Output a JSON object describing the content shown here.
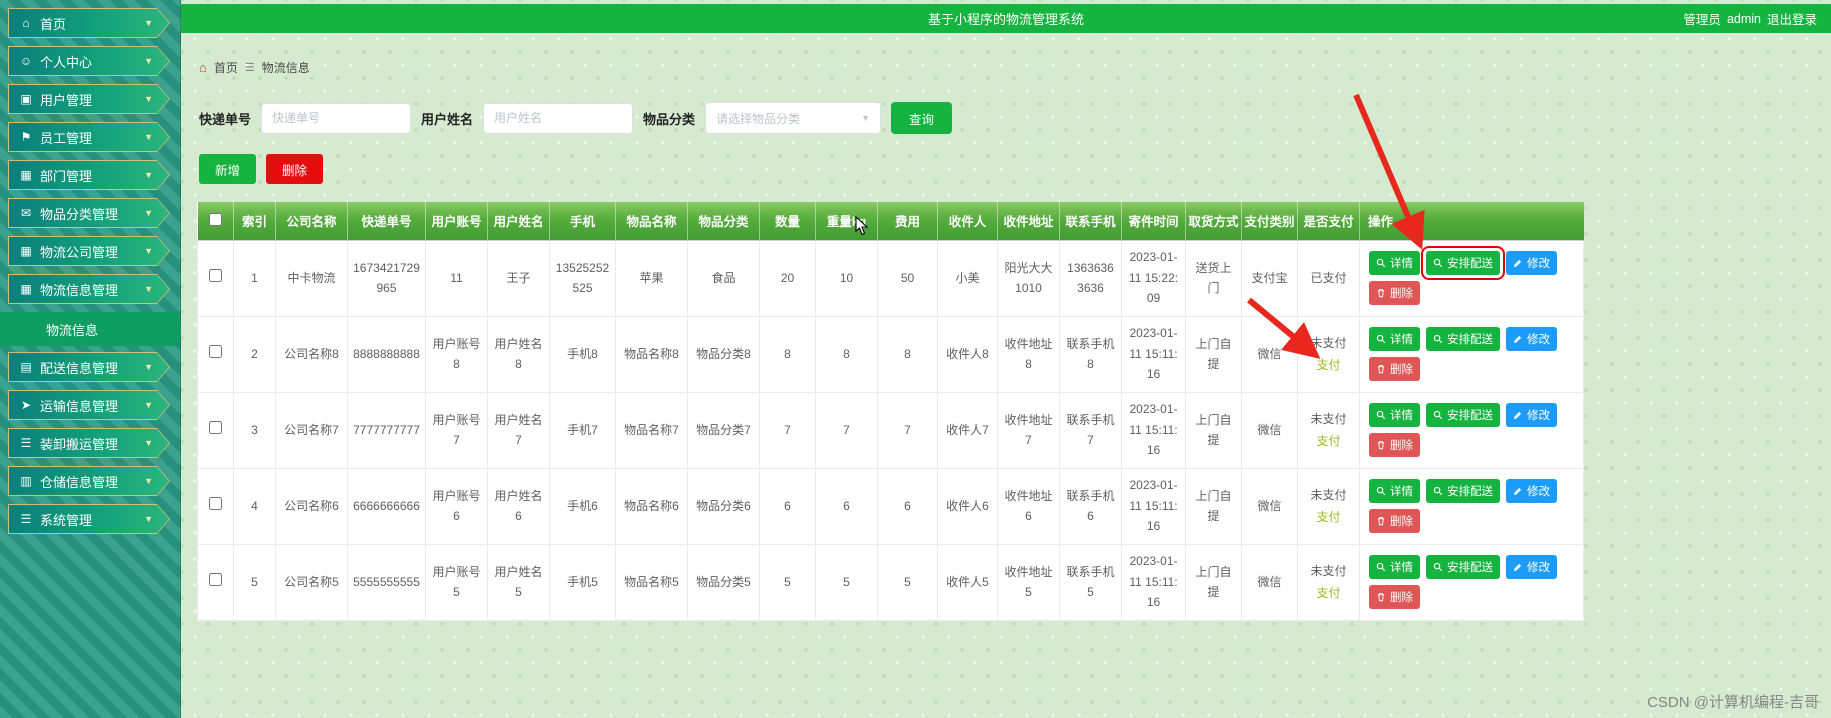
{
  "app": {
    "title": "基于小程序的物流管理系统",
    "user_role": "管理员",
    "username": "admin",
    "logout": "退出登录"
  },
  "sidebar": {
    "items": [
      {
        "label": "首页",
        "icon": "home-icon"
      },
      {
        "label": "个人中心",
        "icon": "user-icon"
      },
      {
        "label": "用户管理",
        "icon": "users-icon"
      },
      {
        "label": "员工管理",
        "icon": "flag-icon"
      },
      {
        "label": "部门管理",
        "icon": "department-icon"
      },
      {
        "label": "物品分类管理",
        "icon": "category-icon"
      },
      {
        "label": "物流公司管理",
        "icon": "company-icon"
      },
      {
        "label": "物流信息管理",
        "icon": "logistics-info-icon"
      },
      {
        "label": "物流信息",
        "type": "sub",
        "active": true
      },
      {
        "label": "配送信息管理",
        "icon": "delivery-icon"
      },
      {
        "label": "运输信息管理",
        "icon": "transport-icon"
      },
      {
        "label": "装卸搬运管理",
        "icon": "handling-icon"
      },
      {
        "label": "仓储信息管理",
        "icon": "warehouse-icon"
      },
      {
        "label": "系统管理",
        "icon": "system-icon"
      }
    ]
  },
  "breadcrumb": {
    "home": "首页",
    "current": "物流信息"
  },
  "filters": {
    "express_label": "快递单号",
    "express_placeholder": "快递单号",
    "name_label": "用户姓名",
    "name_placeholder": "用户姓名",
    "category_label": "物品分类",
    "category_placeholder": "请选择物品分类",
    "search_button": "查询"
  },
  "toolbar": {
    "add_button": "新增",
    "delete_button": "删除"
  },
  "table": {
    "columns": [
      {
        "key": "index",
        "label": "索引"
      },
      {
        "key": "company",
        "label": "公司名称"
      },
      {
        "key": "express_no",
        "label": "快递单号"
      },
      {
        "key": "account",
        "label": "用户账号"
      },
      {
        "key": "username",
        "label": "用户姓名"
      },
      {
        "key": "phone",
        "label": "手机"
      },
      {
        "key": "item_name",
        "label": "物品名称"
      },
      {
        "key": "category",
        "label": "物品分类"
      },
      {
        "key": "quantity",
        "label": "数量"
      },
      {
        "key": "weight",
        "label": "重量kg"
      },
      {
        "key": "fee",
        "label": "费用"
      },
      {
        "key": "receiver",
        "label": "收件人"
      },
      {
        "key": "address",
        "label": "收件地址"
      },
      {
        "key": "contact_phone",
        "label": "联系手机"
      },
      {
        "key": "send_time",
        "label": "寄件时间"
      },
      {
        "key": "pickup_method",
        "label": "取货方式"
      },
      {
        "key": "pay_type",
        "label": "支付类别"
      },
      {
        "key": "paid_status",
        "label": "是否支付"
      },
      {
        "key": "actions",
        "label": "操作"
      }
    ],
    "action_labels": {
      "detail": "详情",
      "arrange": "安排配送",
      "edit": "修改",
      "delete": "删除",
      "pay": "支付"
    },
    "rows": [
      {
        "index": "1",
        "company": "中卡物流",
        "express_no": "1673421729965",
        "account": "11",
        "username": "王子",
        "phone": "13525252525",
        "item_name": "苹果",
        "category": "食品",
        "quantity": "20",
        "weight": "10",
        "fee": "50",
        "receiver": "小美",
        "address": "阳光大大1010",
        "contact_phone": "13636363636",
        "send_time": "2023-01-11 15:22:09",
        "pickup_method": "送货上门",
        "pay_type": "支付宝",
        "paid_status": "已支付",
        "show_pay_link": false,
        "highlight_arrange": true
      },
      {
        "index": "2",
        "company": "公司名称8",
        "express_no": "8888888888",
        "account": "用户账号8",
        "username": "用户姓名8",
        "phone": "手机8",
        "item_name": "物品名称8",
        "category": "物品分类8",
        "quantity": "8",
        "weight": "8",
        "fee": "8",
        "receiver": "收件人8",
        "address": "收件地址8",
        "contact_phone": "联系手机8",
        "send_time": "2023-01-11 15:11:16",
        "pickup_method": "上门自提",
        "pay_type": "微信",
        "paid_status": "未支付",
        "show_pay_link": true,
        "highlight_arrange": false
      },
      {
        "index": "3",
        "company": "公司名称7",
        "express_no": "7777777777",
        "account": "用户账号7",
        "username": "用户姓名7",
        "phone": "手机7",
        "item_name": "物品名称7",
        "category": "物品分类7",
        "quantity": "7",
        "weight": "7",
        "fee": "7",
        "receiver": "收件人7",
        "address": "收件地址7",
        "contact_phone": "联系手机7",
        "send_time": "2023-01-11 15:11:16",
        "pickup_method": "上门自提",
        "pay_type": "微信",
        "paid_status": "未支付",
        "show_pay_link": true,
        "highlight_arrange": false
      },
      {
        "index": "4",
        "company": "公司名称6",
        "express_no": "6666666666",
        "account": "用户账号6",
        "username": "用户姓名6",
        "phone": "手机6",
        "item_name": "物品名称6",
        "category": "物品分类6",
        "quantity": "6",
        "weight": "6",
        "fee": "6",
        "receiver": "收件人6",
        "address": "收件地址6",
        "contact_phone": "联系手机6",
        "send_time": "2023-01-11 15:11:16",
        "pickup_method": "上门自提",
        "pay_type": "微信",
        "paid_status": "未支付",
        "show_pay_link": true,
        "highlight_arrange": false
      },
      {
        "index": "5",
        "company": "公司名称5",
        "express_no": "5555555555",
        "account": "用户账号5",
        "username": "用户姓名5",
        "phone": "手机5",
        "item_name": "物品名称5",
        "category": "物品分类5",
        "quantity": "5",
        "weight": "5",
        "fee": "5",
        "receiver": "收件人5",
        "address": "收件地址5",
        "contact_phone": "联系手机5",
        "send_time": "2023-01-11 15:11:16",
        "pickup_method": "上门自提",
        "pay_type": "微信",
        "paid_status": "未支付",
        "show_pay_link": true,
        "highlight_arrange": false
      }
    ]
  },
  "annotations": {
    "watermark": "CSDN @计算机编程-吉哥"
  }
}
